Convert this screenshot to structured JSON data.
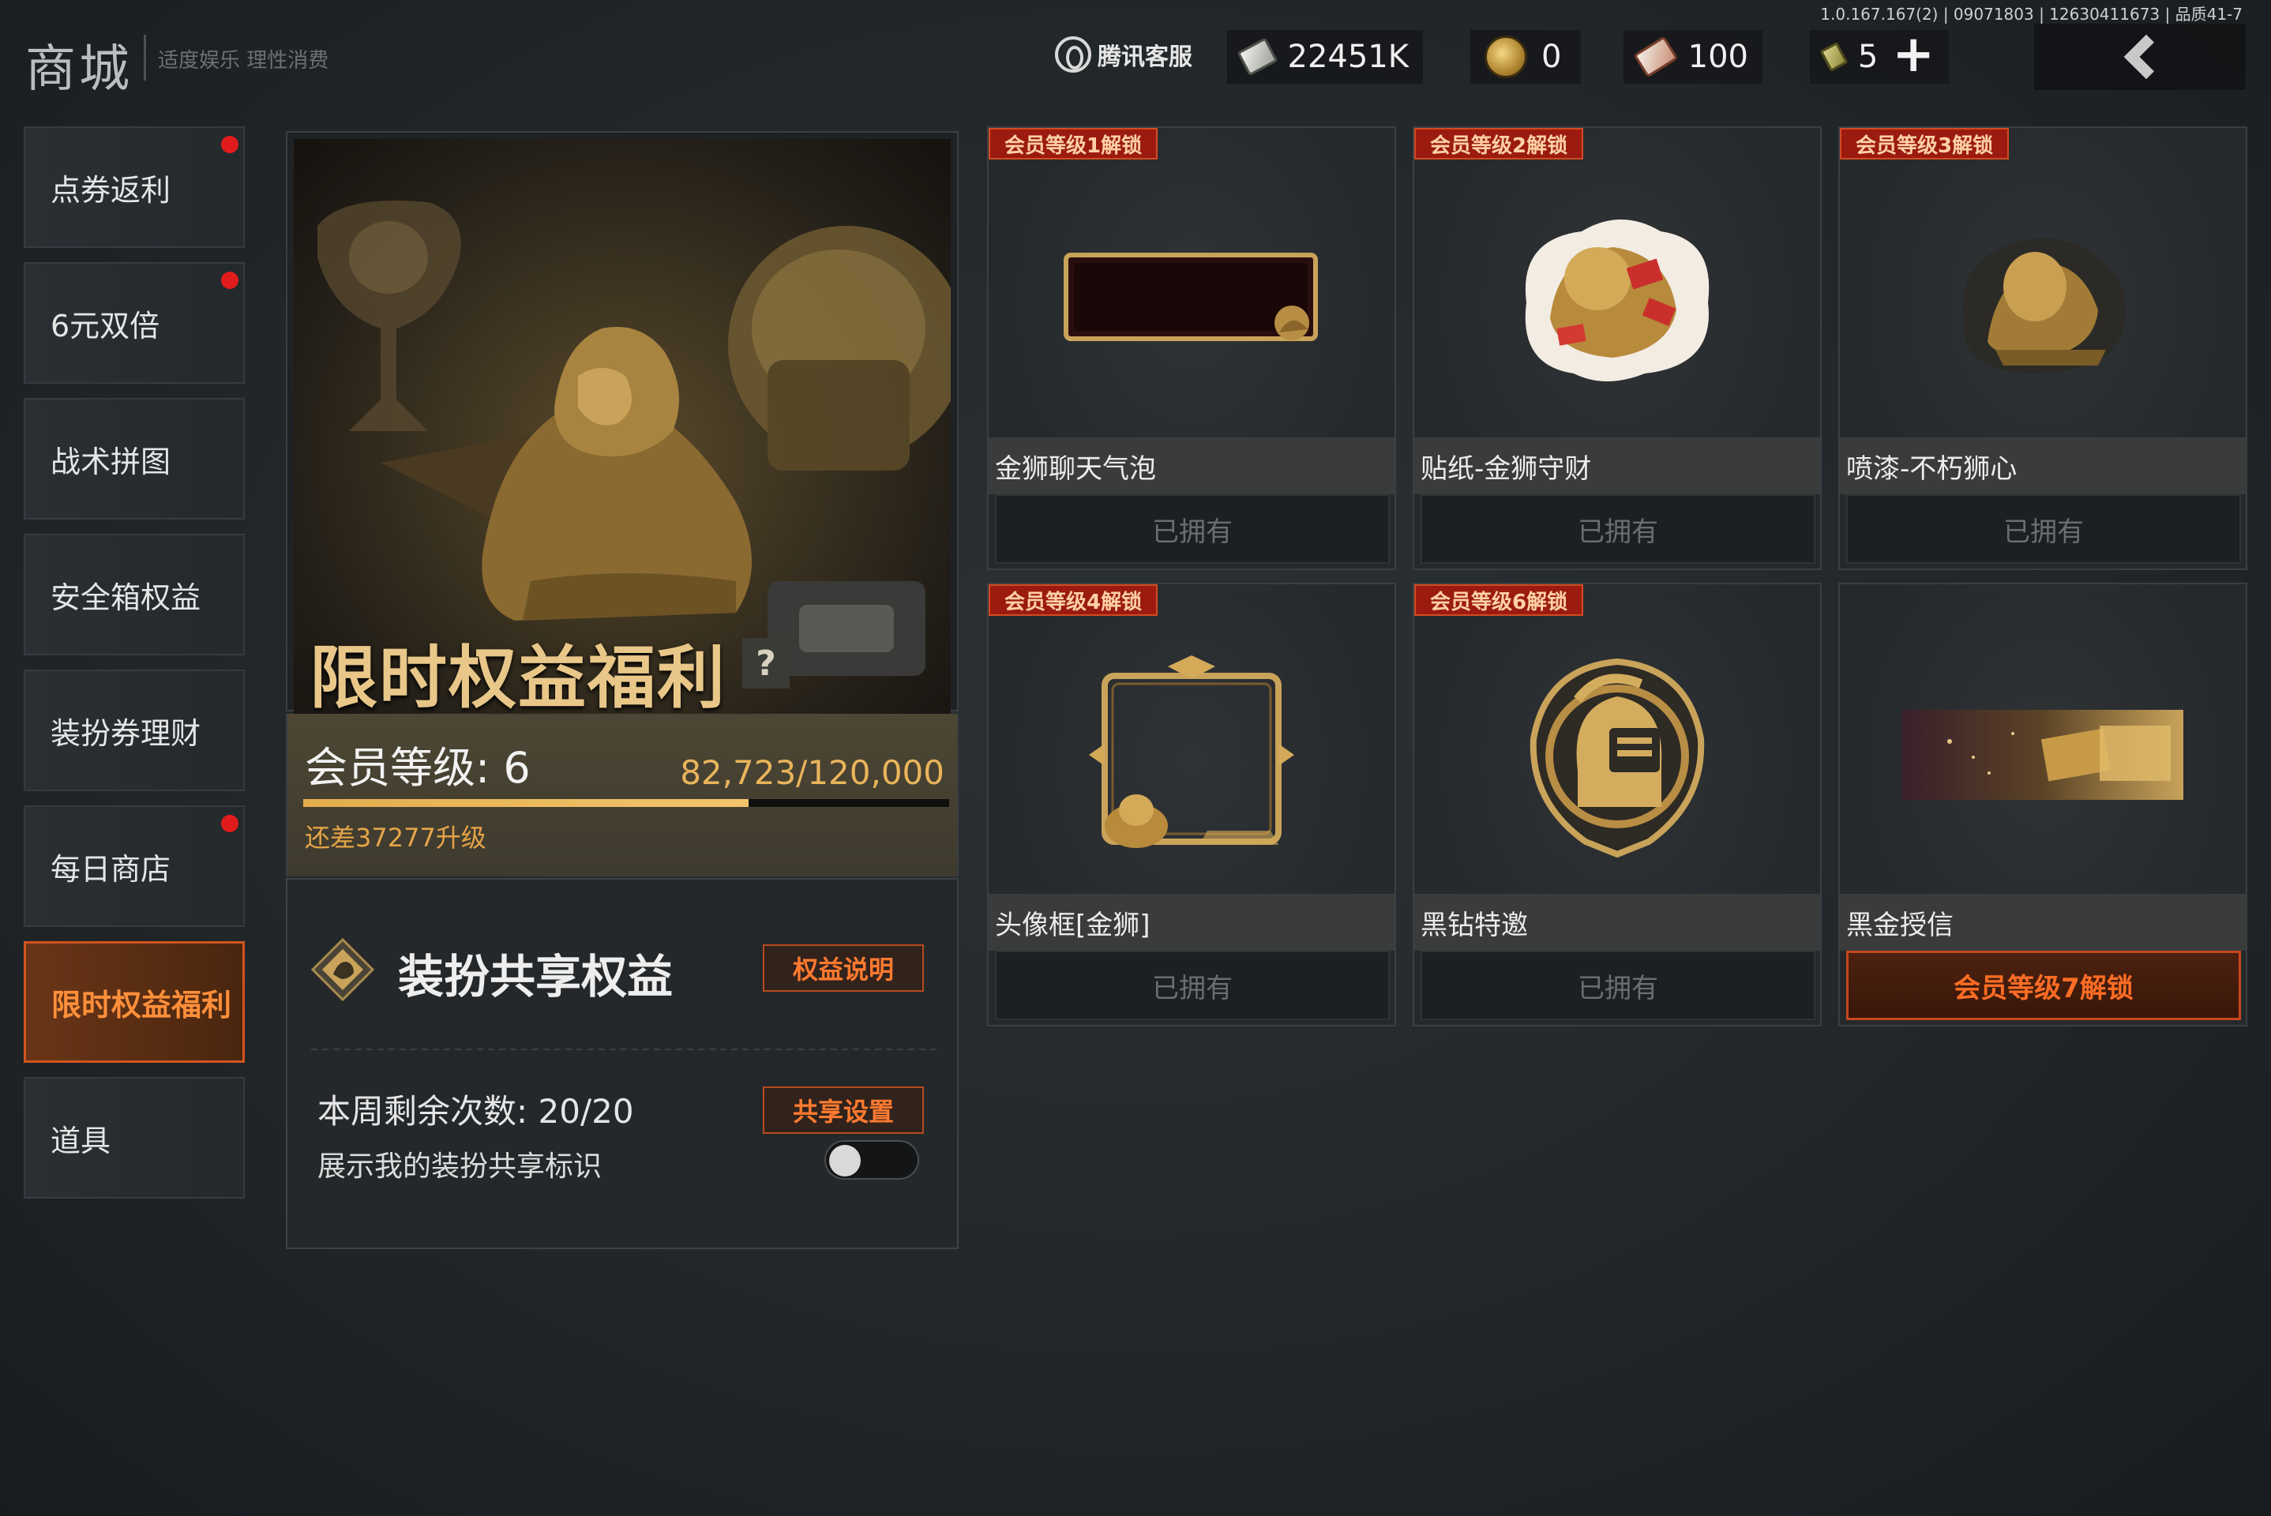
{
  "build_info": "1.0.167.167(2) | 09071803 | 12630411673 | 品质41-7",
  "header": {
    "title": "商城",
    "subtitle": "适度娱乐 理性消费",
    "service_label": "腾讯客服"
  },
  "currencies": [
    {
      "icon": "cash-icon",
      "value": "22451K"
    },
    {
      "icon": "coin-icon",
      "value": "0"
    },
    {
      "icon": "voucher-ticket-icon",
      "value": "100"
    },
    {
      "icon": "note-icon",
      "value": "5"
    }
  ],
  "sidebar": {
    "items": [
      {
        "label": "点券返利",
        "badge": true,
        "active": false
      },
      {
        "label": "6元双倍",
        "badge": true,
        "active": false
      },
      {
        "label": "战术拼图",
        "badge": false,
        "active": false
      },
      {
        "label": "安全箱权益",
        "badge": false,
        "active": false
      },
      {
        "label": "装扮券理财",
        "badge": false,
        "active": false
      },
      {
        "label": "每日商店",
        "badge": true,
        "active": false
      },
      {
        "label": "限时权益福利",
        "badge": false,
        "active": true
      },
      {
        "label": "道具",
        "badge": false,
        "active": false
      }
    ]
  },
  "hero": {
    "title": "限时权益福利",
    "help": "?"
  },
  "member": {
    "level_label": "会员等级: 6",
    "progress_text": "82,723/120,000",
    "progress_ratio": 0.689,
    "need_text": "还差37277升级"
  },
  "share": {
    "title": "装扮共享权益",
    "explain_button": "权益说明",
    "settings_button": "共享设置",
    "weekly_label": "本周剩余次数: 20/20",
    "show_label": "展示我的装扮共享标识",
    "show_enabled": false
  },
  "rewards": [
    {
      "tag": "会员等级1解锁",
      "name": "金狮聊天气泡",
      "status": "已拥有",
      "owned": true,
      "icon": "chat-bubble-frame-icon"
    },
    {
      "tag": "会员等级2解锁",
      "name": "贴纸-金狮守财",
      "status": "已拥有",
      "owned": true,
      "icon": "lion-sticker-icon"
    },
    {
      "tag": "会员等级3解锁",
      "name": "喷漆-不朽狮心",
      "status": "已拥有",
      "owned": true,
      "icon": "lion-spray-icon"
    },
    {
      "tag": "会员等级4解锁",
      "name": "头像框[金狮]",
      "status": "已拥有",
      "owned": true,
      "icon": "avatar-frame-icon"
    },
    {
      "tag": "会员等级6解锁",
      "name": "黑钻特邀",
      "status": "已拥有",
      "owned": true,
      "icon": "helmet-badge-icon"
    },
    {
      "tag": "",
      "name": "黑金授信",
      "status": "会员等级7解锁",
      "owned": false,
      "icon": "gold-card-icon"
    }
  ],
  "colors": {
    "accent": "#ff7a30",
    "active_border": "#d2541f",
    "gold": "#e9b55b",
    "tag_bg": "#9b1b10",
    "badge_dot": "#e11c1c"
  }
}
